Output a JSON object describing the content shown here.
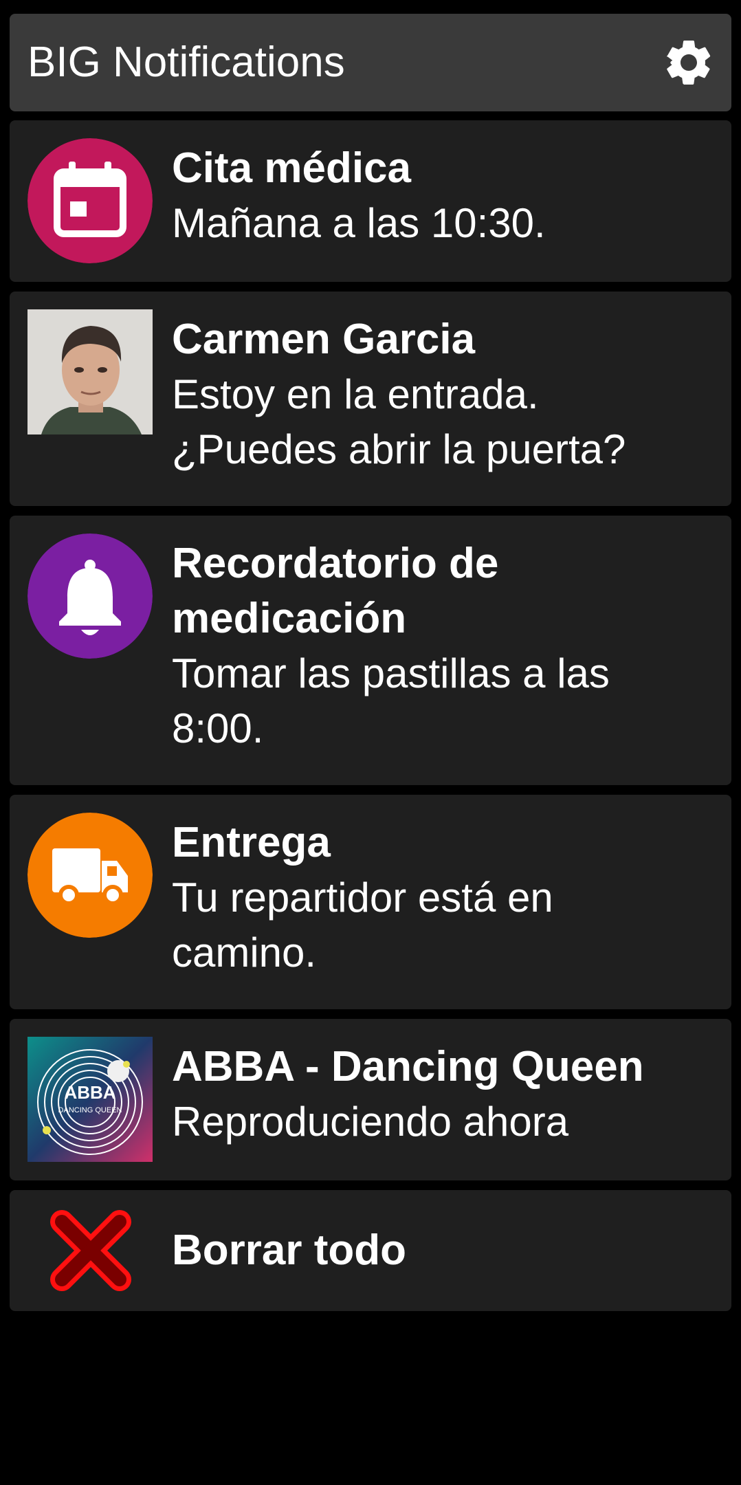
{
  "header": {
    "title": "BIG Notifications",
    "settings_icon": "gear-icon"
  },
  "notifications": [
    {
      "title": "Cita médica",
      "body": "Mañana a las 10:30.",
      "icon": "calendar-icon",
      "icon_color": "#c2185b"
    },
    {
      "title": "Carmen Garcia",
      "body_line1": "Estoy en la entrada.",
      "body_line2": "¿Puedes abrir la puerta?",
      "icon": "contact-photo"
    },
    {
      "title_line1": "Recordatorio de",
      "title_line2": "medicación",
      "body_line1": "Tomar las pastillas a las",
      "body_line2": "8:00.",
      "icon": "bell-icon",
      "icon_color": "#7b1fa2"
    },
    {
      "title": "Entrega",
      "body_line1": "Tu repartidor está en",
      "body_line2": "camino.",
      "icon": "truck-icon",
      "icon_color": "#f57c00"
    },
    {
      "title": "ABBA - Dancing Queen",
      "body": "Reproduciendo ahora",
      "icon": "album-art",
      "art_text": "ABBA",
      "art_subtext": "DANCING QUEEN"
    }
  ],
  "clear_all": {
    "label": "Borrar todo",
    "icon": "close-icon",
    "icon_color": "#e00000"
  },
  "colors": {
    "background": "#000000",
    "header_bg": "#3a3a3a",
    "card_bg": "#1f1f1f",
    "text": "#ffffff"
  }
}
